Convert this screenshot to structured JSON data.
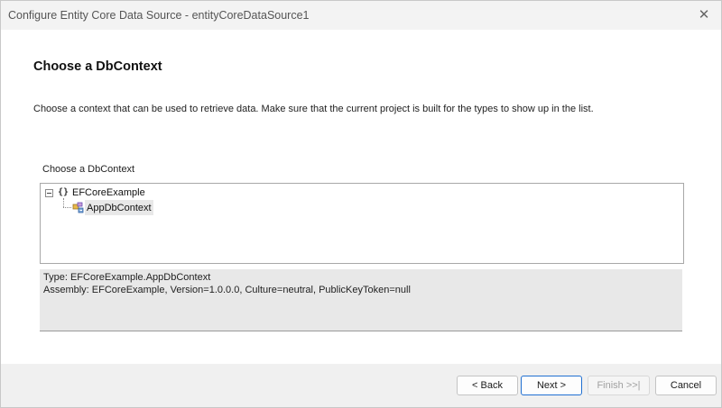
{
  "window": {
    "title": "Configure Entity Core Data Source - entityCoreDataSource1",
    "close_glyph": "✕"
  },
  "page": {
    "heading": "Choose a DbContext",
    "description": "Choose a context that can be used to retrieve data. Make sure that the current project is built for the types to show up in the list."
  },
  "selector": {
    "label": "Choose a DbContext",
    "tree": {
      "namespace_icon": "{}",
      "namespace": "EFCoreExample",
      "context": "AppDbContext"
    }
  },
  "info": {
    "type_line": "Type: EFCoreExample.AppDbContext",
    "assembly_line": "Assembly: EFCoreExample, Version=1.0.0.0, Culture=neutral, PublicKeyToken=null"
  },
  "buttons": {
    "back": "< Back",
    "next": "Next >",
    "finish": "Finish >>|",
    "cancel": "Cancel"
  },
  "colors": {
    "accent": "#1f6fd1",
    "class_icon": "#6a4fb5"
  },
  "icons": {
    "close": "close-icon",
    "expander": "collapse-icon",
    "namespace": "namespace-icon",
    "class": "class-icon"
  }
}
